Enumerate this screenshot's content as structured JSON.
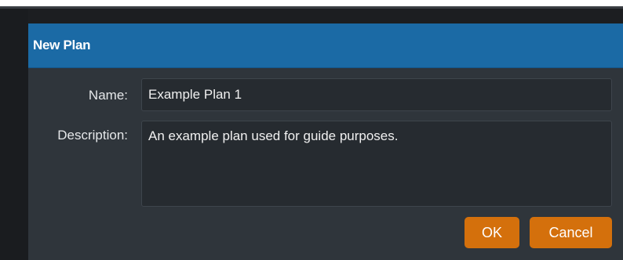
{
  "dialog": {
    "title": "New Plan",
    "name_label": "Name:",
    "name_value": "Example Plan 1",
    "description_label": "Description:",
    "description_value": "An example plan used for guide purposes.",
    "ok_label": "OK",
    "cancel_label": "Cancel"
  },
  "colors": {
    "titlebar": "#1b6aa5",
    "dialog_body": "#2f353b",
    "field_bg": "#262b30",
    "button": "#d4700c"
  }
}
